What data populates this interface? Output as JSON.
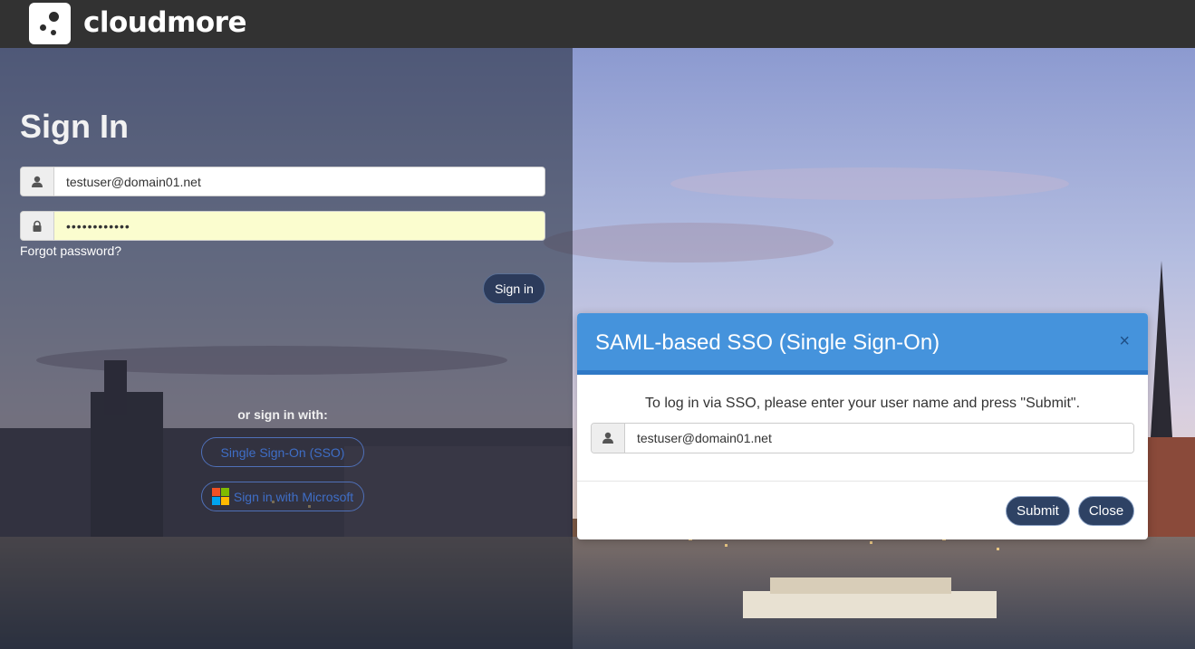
{
  "brand": {
    "name": "cloudmore",
    "logo_icon": "cloudmore-dots-logo"
  },
  "signin": {
    "title": "Sign In",
    "username_value": "testuser@domain01.net",
    "password_value": "••••••••••••",
    "forgot_label": "Forgot password?",
    "signin_label": "Sign in",
    "or_label": "or sign in with:",
    "sso_label": "Single Sign-On (SSO)",
    "microsoft_label": "Sign in with Microsoft",
    "user_icon": "user-icon",
    "lock_icon": "lock-icon"
  },
  "modal": {
    "title": "SAML-based SSO (Single Sign-On)",
    "close_glyph": "×",
    "message": "To log in via SSO, please enter your user name and press \"Submit\".",
    "username_value": "testuser@domain01.net",
    "submit_label": "Submit",
    "close_label": "Close"
  },
  "colors": {
    "topbar": "#323232",
    "modal_header": "#4593dc",
    "button_dark": "#2e4264",
    "sso_outline": "#4f70b8"
  }
}
